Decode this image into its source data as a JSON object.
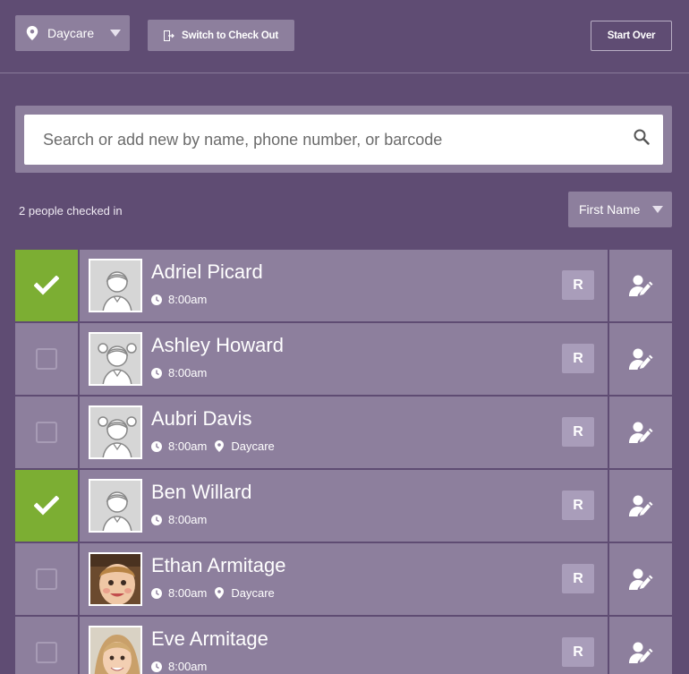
{
  "topbar": {
    "location": "Daycare",
    "switch_label": "Switch to Check Out",
    "start_over_label": "Start Over"
  },
  "search": {
    "placeholder": "Search or add new by name, phone number, or barcode"
  },
  "list_header": {
    "checked_in_text": "2 people checked in",
    "sort_label": "First Name"
  },
  "people": [
    {
      "name": "Adriel Picard",
      "time": "8:00am",
      "location": "",
      "checked": true,
      "avatar": "boy-placeholder",
      "badge": "R"
    },
    {
      "name": "Ashley Howard",
      "time": "8:00am",
      "location": "",
      "checked": false,
      "avatar": "girl-placeholder",
      "badge": "R"
    },
    {
      "name": "Aubri Davis",
      "time": "8:00am",
      "location": "Daycare",
      "checked": false,
      "avatar": "girl-placeholder",
      "badge": "R"
    },
    {
      "name": "Ben Willard",
      "time": "8:00am",
      "location": "",
      "checked": true,
      "avatar": "boy-placeholder",
      "badge": "R"
    },
    {
      "name": "Ethan Armitage",
      "time": "8:00am",
      "location": "Daycare",
      "checked": false,
      "avatar": "photo-boy",
      "badge": "R"
    },
    {
      "name": "Eve Armitage",
      "time": "8:00am",
      "location": "",
      "checked": false,
      "avatar": "photo-girl",
      "badge": "R"
    }
  ],
  "colors": {
    "background": "#5f4c73",
    "panel": "#8d7f9d",
    "checked": "#7cae33",
    "badge": "#a99dba"
  }
}
